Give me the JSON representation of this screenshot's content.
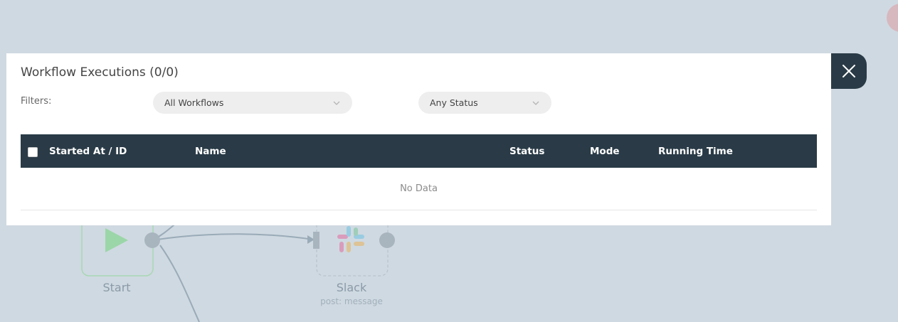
{
  "dialog": {
    "title": "Workflow Executions (0/0)",
    "filters_label": "Filters:",
    "workflow_filter": {
      "selected": "All Workflows"
    },
    "status_filter": {
      "selected": "Any Status"
    },
    "table": {
      "columns": [
        "Started At / ID",
        "Name",
        "Status",
        "Mode",
        "Running Time"
      ],
      "empty_text": "No Data"
    },
    "close_icon": "close-icon"
  },
  "canvas": {
    "nodes": [
      {
        "label": "Start",
        "icon": "play-icon",
        "color": "#98d9a6"
      },
      {
        "label": "Slack",
        "sublabel": "post: message",
        "icon": "slack-icon"
      }
    ]
  },
  "colors": {
    "header_bg": "#2a3b47",
    "canvas_bg": "#cfd9e1",
    "dialog_bg": "#ffffff"
  }
}
